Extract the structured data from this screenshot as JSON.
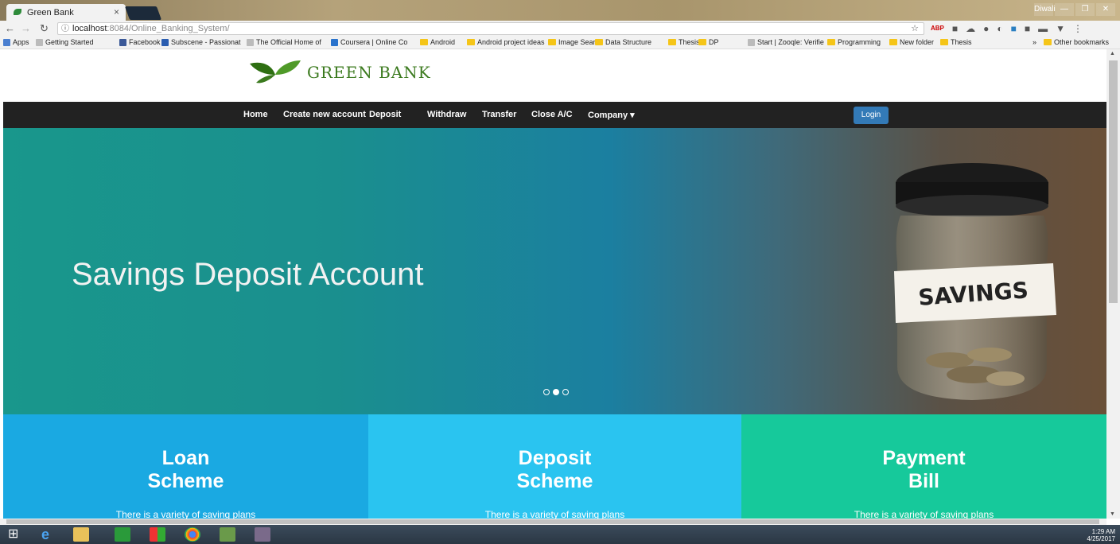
{
  "browser": {
    "tab_title": "Green Bank",
    "tab_close": "×",
    "url_host": "localhost",
    "url_rest": ":8084/Online_Banking_System/",
    "window_controls": [
      "Diwali",
      "—",
      "❐",
      "✕"
    ]
  },
  "bookmarks": [
    {
      "label": "Apps",
      "icon": "apps-icon"
    },
    {
      "label": "Getting Started",
      "icon": "page-icon"
    },
    {
      "label": "Facebook",
      "icon": "facebook-icon"
    },
    {
      "label": "Subscene - Passionat",
      "icon": "subscene-icon"
    },
    {
      "label": "The Official Home of",
      "icon": "site-icon"
    },
    {
      "label": "Coursera | Online Co",
      "icon": "coursera-icon"
    },
    {
      "label": "Android",
      "icon": "folder-icon"
    },
    {
      "label": "Android project ideas",
      "icon": "folder-icon"
    },
    {
      "label": "Image Search",
      "icon": "folder-icon"
    },
    {
      "label": "Data Structure",
      "icon": "folder-icon"
    },
    {
      "label": "Thesis",
      "icon": "folder-icon"
    },
    {
      "label": "DP",
      "icon": "folder-icon"
    },
    {
      "label": "Start | Zooqle: Verifie",
      "icon": "site-icon"
    },
    {
      "label": "Programming",
      "icon": "folder-icon"
    },
    {
      "label": "New folder",
      "icon": "folder-icon"
    },
    {
      "label": "Thesis",
      "icon": "folder-icon"
    },
    {
      "label": "»",
      "icon": ""
    },
    {
      "label": "Other bookmarks",
      "icon": "folder-icon"
    }
  ],
  "site": {
    "logo_text": "GREEN BANK",
    "nav": [
      "Home",
      "Create new account",
      "Deposit",
      "Withdraw",
      "Transfer",
      "Close A/C",
      "Company ▾"
    ],
    "login_label": "Login",
    "hero_title": "Savings Deposit Account",
    "jar_label": "SAVINGS",
    "carousel_active": 2,
    "cards": [
      {
        "line1": "Loan",
        "line2": "Scheme",
        "desc": "There is a variety of saving plans",
        "color": "#1aa9e2"
      },
      {
        "line1": "Deposit",
        "line2": "Scheme",
        "desc": "There is a variety of saving plans",
        "color": "#2ac4f0"
      },
      {
        "line1": "Payment",
        "line2": "Bill",
        "desc": "There is a variety of saving plans",
        "color": "#16c99b"
      }
    ]
  },
  "taskbar": {
    "time": "1:29 AM",
    "date": "4/25/2017"
  },
  "colors": {
    "navbar": "#222222",
    "login": "#337ab7",
    "logo_green": "#3b7a1e"
  }
}
